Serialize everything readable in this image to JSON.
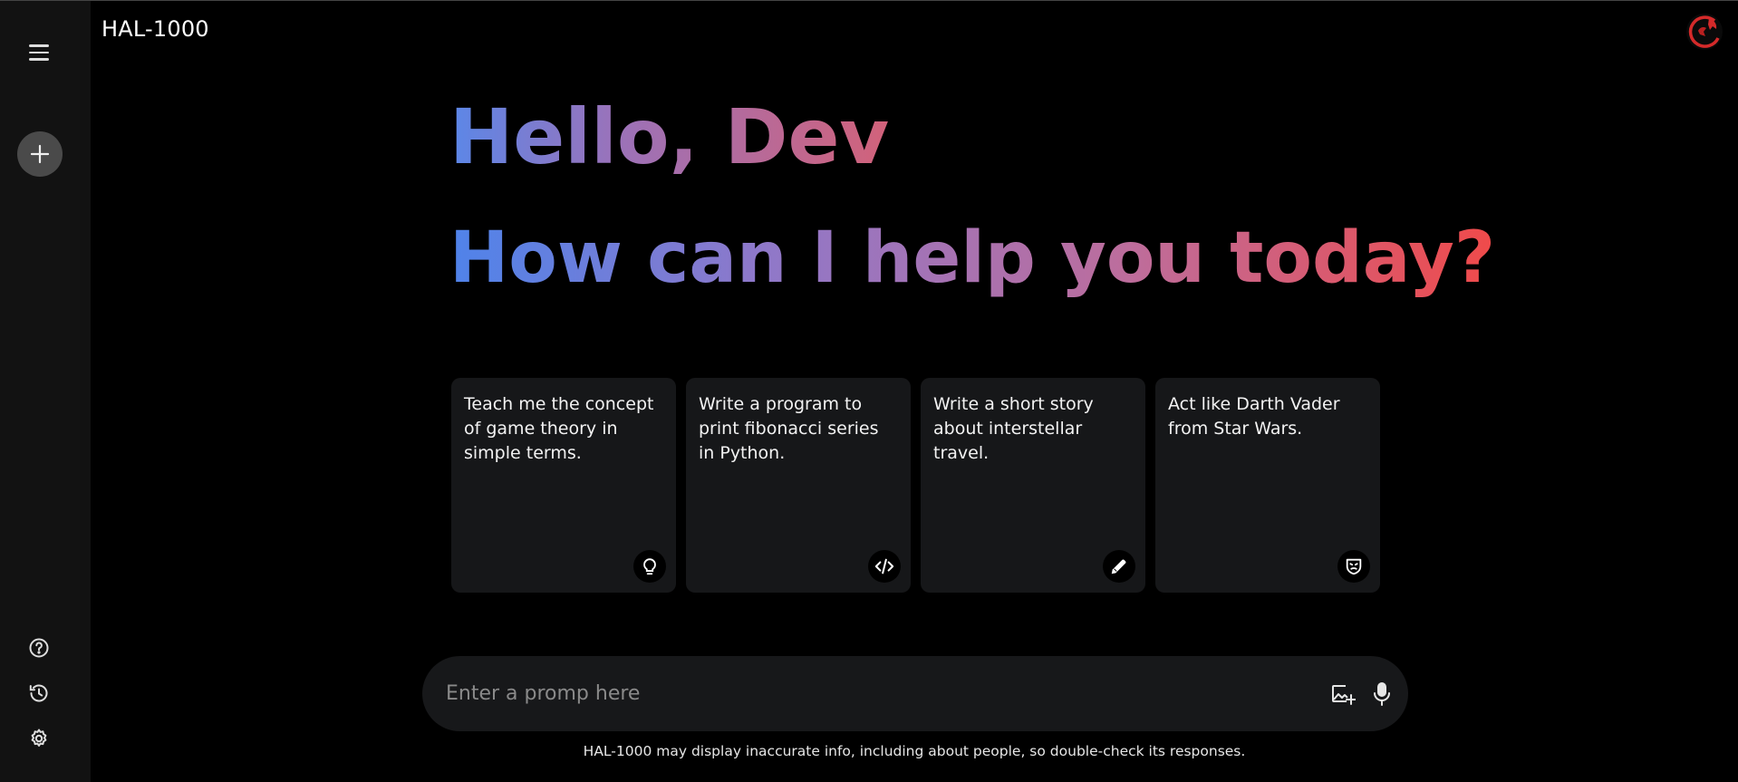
{
  "app": {
    "title": "HAL-1000"
  },
  "greeting": {
    "line1": "Hello, Dev",
    "line2": "How can I help you today?"
  },
  "cards": [
    {
      "text": "Teach me the concept of game theory in simple terms.",
      "icon": "lightbulb-icon"
    },
    {
      "text": "Write a program to print fibonacci series in Python.",
      "icon": "code-icon"
    },
    {
      "text": "Write a short story about interstellar travel.",
      "icon": "pencil-icon"
    },
    {
      "text": "Act like Darth Vader from Star Wars.",
      "icon": "mask-icon"
    }
  ],
  "prompt": {
    "placeholder": "Enter a promp here"
  },
  "disclaimer": "HAL-1000 may display inaccurate info, including about people, so double-check its responses.",
  "sidebar": {
    "icons": [
      "menu-icon",
      "plus-icon",
      "help-icon",
      "history-icon",
      "settings-icon"
    ]
  },
  "colors": {
    "background": "#000000",
    "sidebar": "#121212",
    "card": "#161719",
    "accent_blue": "#4f83ea",
    "accent_red": "#f04a4a"
  }
}
